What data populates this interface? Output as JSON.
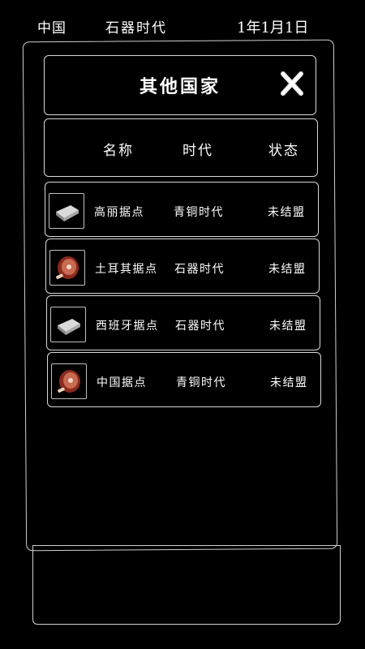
{
  "topbar": {
    "country": "中国",
    "era": "石器时代",
    "date": "1年1月1日"
  },
  "dialog": {
    "title": "其他国家"
  },
  "columns": {
    "name": "名称",
    "era": "时代",
    "status": "状态"
  },
  "rows": [
    {
      "icon": "silver-ingot-icon",
      "name": "高丽据点",
      "era": "青铜时代",
      "status": "未结盟"
    },
    {
      "icon": "ham-meat-icon",
      "name": "土耳其据点",
      "era": "石器时代",
      "status": "未结盟"
    },
    {
      "icon": "silver-ingot-icon",
      "name": "西班牙据点",
      "era": "石器时代",
      "status": "未结盟"
    },
    {
      "icon": "ham-meat-icon",
      "name": "中国据点",
      "era": "青铜时代",
      "status": "未结盟"
    }
  ]
}
